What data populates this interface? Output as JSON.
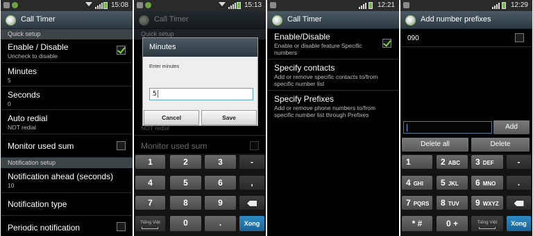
{
  "status": {
    "panel1_time": "15:08",
    "panel2_time": "15:13",
    "panel3_time": "12:21",
    "panel4_time": "12:29"
  },
  "panel1": {
    "title": "Call Timer",
    "sections": [
      "Quick setup",
      "Notification setup"
    ],
    "items": [
      {
        "title": "Enable / Disable",
        "subtitle": "Uncheck to disable",
        "checked": true
      },
      {
        "title": "Minutes",
        "subtitle": "5"
      },
      {
        "title": "Seconds",
        "subtitle": "0"
      },
      {
        "title": "Auto redial",
        "subtitle": "NOT redial"
      },
      {
        "title": "Monitor used sum",
        "checked": false
      },
      {
        "title": "Notification ahead (seconds)",
        "subtitle": "10"
      },
      {
        "title": "Notification type"
      },
      {
        "title": "Periodic notification",
        "checked": false
      }
    ]
  },
  "panel2": {
    "title": "Call Timer",
    "bg_section": "Quick setup",
    "bg_items": [
      "NOT redial",
      "Monitor used sum"
    ],
    "dialog": {
      "title": "Minutes",
      "label": "Enter minutes",
      "value": "5",
      "cancel": "Cancel",
      "save": "Save"
    },
    "keypad": {
      "row1": [
        "1",
        "2",
        "3",
        "-"
      ],
      "row2": [
        "4",
        "5",
        "6",
        ","
      ],
      "row3": [
        "7",
        "8",
        "9"
      ],
      "row4": [
        "Tiếng Việt",
        "0",
        ".",
        "Xong"
      ]
    }
  },
  "panel3": {
    "title": "Call Timer",
    "items": [
      {
        "title": "Enable/Disable",
        "subtitle": "Enable or disable feature Specific numbers",
        "checked": true
      },
      {
        "title": "Specify contacts",
        "subtitle": "Add or remove specific contacts to/from specific number list"
      },
      {
        "title": "Specify Prefixes",
        "subtitle": "Add or remove phone numbers to/from specific number list through Prefixes"
      }
    ]
  },
  "panel4": {
    "title": "Add number prefixes",
    "prefixes": [
      {
        "code": "090",
        "checked": false
      }
    ],
    "input_value": "",
    "add": "Add",
    "delete_all": "Delete all",
    "delete": "Delete",
    "keypad": {
      "row1": [
        {
          "d": "1",
          "l": ""
        },
        {
          "d": "2",
          "l": "ABC"
        },
        {
          "d": "3",
          "l": "DEF"
        },
        {
          "d": "-",
          "l": ""
        }
      ],
      "row2": [
        {
          "d": "4",
          "l": "GHI"
        },
        {
          "d": "5",
          "l": "JKL"
        },
        {
          "d": "6",
          "l": "MNO"
        },
        {
          "d": ".",
          "l": ""
        }
      ],
      "row3": [
        {
          "d": "7",
          "l": "PQRS"
        },
        {
          "d": "8",
          "l": "TUV"
        },
        {
          "d": "9",
          "l": "WXYZ"
        }
      ],
      "row4": [
        {
          "d": "* #",
          "l": ""
        },
        {
          "d": "0 +",
          "l": ""
        },
        {
          "d": "Tiếng Việt",
          "l": ""
        },
        {
          "d": "Xong",
          "l": ""
        }
      ]
    }
  },
  "colors": {
    "accent": "#7cd33a",
    "titlebar": "#3d4a52",
    "action": "#1d6394"
  }
}
